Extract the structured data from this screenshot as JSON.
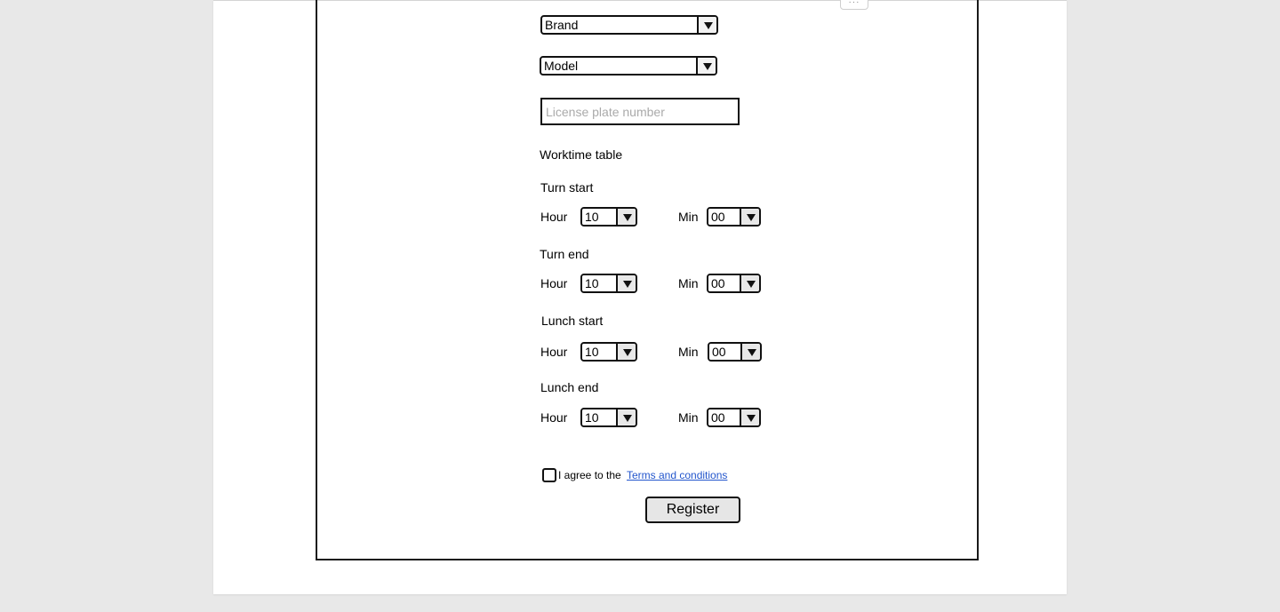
{
  "form": {
    "brand_select": {
      "value": "Brand"
    },
    "model_select": {
      "value": "Model"
    },
    "license_plate": {
      "placeholder": "License plate number",
      "value": ""
    },
    "worktime_title": "Worktime table",
    "hour_label": "Hour",
    "min_label": "Min",
    "sections": [
      {
        "title": "Turn start",
        "hour": "10",
        "min": "00"
      },
      {
        "title": "Turn end",
        "hour": "10",
        "min": "00"
      },
      {
        "title": "Lunch start",
        "hour": "10",
        "min": "00"
      },
      {
        "title": "Lunch end",
        "hour": "10",
        "min": "00"
      }
    ],
    "agree_text": "I agree to the",
    "terms_link": "Terms and conditions",
    "register_button": "Register"
  },
  "toolbar": {
    "handle_glyph": "···"
  }
}
